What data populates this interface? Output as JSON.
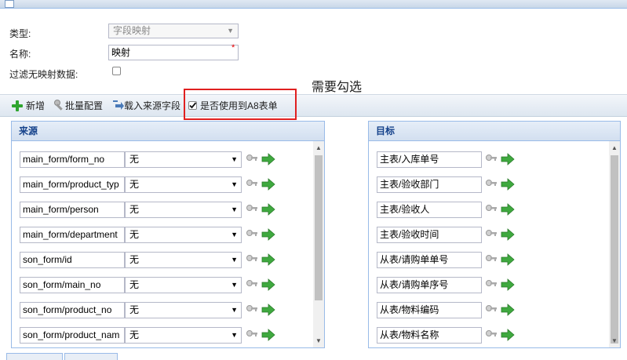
{
  "form": {
    "type_label": "类型:",
    "type_value": "字段映射",
    "name_label": "名称:",
    "name_value": "映射",
    "filter_label": "过滤无映射数据:",
    "filter_checked": false
  },
  "annotation": "需要勾选",
  "toolbar": {
    "add_label": "新增",
    "batch_label": "批量配置",
    "load_label": "载入来源字段",
    "a8_label": "是否使用到A8表单",
    "a8_checked": true
  },
  "source_panel": {
    "title": "来源",
    "rows": [
      {
        "field": "main_form/form_no",
        "mapping": "无"
      },
      {
        "field": "main_form/product_typ",
        "mapping": "无"
      },
      {
        "field": "main_form/person",
        "mapping": "无"
      },
      {
        "field": "main_form/department",
        "mapping": "无"
      },
      {
        "field": "son_form/id",
        "mapping": "无"
      },
      {
        "field": "son_form/main_no",
        "mapping": "无"
      },
      {
        "field": "son_form/product_no",
        "mapping": "无"
      },
      {
        "field": "son_form/product_nam",
        "mapping": "无"
      }
    ]
  },
  "target_panel": {
    "title": "目标",
    "rows": [
      {
        "field": "主表/入库单号"
      },
      {
        "field": "主表/验收部门"
      },
      {
        "field": "主表/验收人"
      },
      {
        "field": "主表/验收时间"
      },
      {
        "field": "从表/请购单单号"
      },
      {
        "field": "从表/请购单序号"
      },
      {
        "field": "从表/物料编码"
      },
      {
        "field": "从表/物料名称"
      }
    ]
  },
  "icons": {
    "key": "key-icon",
    "arrow": "green-arrow-icon",
    "add": "plus-icon",
    "batch": "wrench-icon",
    "load": "load-arrow-icon"
  },
  "colors": {
    "header_text": "#15428b",
    "annotation_box": "#e02020",
    "add_green": "#2fa52f"
  }
}
